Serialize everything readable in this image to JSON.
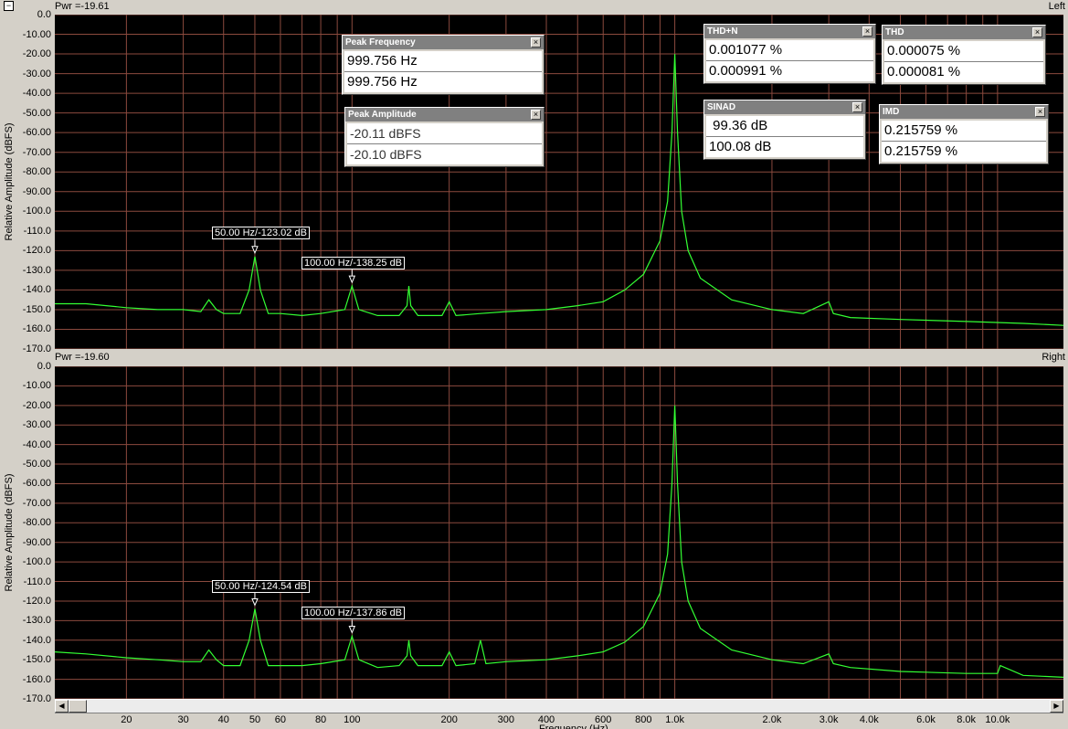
{
  "top_pane": {
    "pwr": "Pwr =-19.61",
    "channel": "Left",
    "markers": [
      {
        "label": "50.00 Hz/-123.02 dB"
      },
      {
        "label": "100.00 Hz/-138.25 dB"
      }
    ]
  },
  "bottom_pane": {
    "pwr": "Pwr =-19.60",
    "channel": "Right",
    "markers": [
      {
        "label": "50.00 Hz/-124.54 dB"
      },
      {
        "label": "100.00 Hz/-137.86 dB"
      }
    ]
  },
  "readouts": {
    "peak_frequency": {
      "title": "Peak Frequency",
      "values": [
        "999.756 Hz",
        "999.756 Hz"
      ]
    },
    "peak_amplitude": {
      "title": "Peak Amplitude",
      "values": [
        "-20.11 dBFS",
        "-20.10 dBFS"
      ]
    },
    "thd_n": {
      "title": "THD+N",
      "values": [
        "0.001077 %",
        "0.000991 %"
      ]
    },
    "thd": {
      "title": "THD",
      "values": [
        "0.000075 %",
        "0.000081 %"
      ]
    },
    "sinad": {
      "title": "SINAD",
      "values": [
        " 99.36 dB",
        "100.08 dB"
      ]
    },
    "imd": {
      "title": "IMD",
      "values": [
        "0.215759 %",
        "0.215759 %"
      ]
    }
  },
  "axes": {
    "y_title": "Relative Amplitude (dBFS)",
    "x_title": "Frequency (Hz)",
    "y_ticks": [
      "0.0",
      "-10.00",
      "-20.00",
      "-30.00",
      "-40.00",
      "-50.00",
      "-60.00",
      "-70.00",
      "-80.00",
      "-90.00",
      "-100.0",
      "-110.0",
      "-120.0",
      "-130.0",
      "-140.0",
      "-150.0",
      "-160.0",
      "-170.0"
    ],
    "x_ticks": [
      "20",
      "30",
      "40",
      "50",
      "60",
      "80",
      "100",
      "200",
      "300",
      "400",
      "600",
      "800",
      "1.0k",
      "2.0k",
      "3.0k",
      "4.0k",
      "6.0k",
      "8.0k",
      "10.0k"
    ]
  },
  "colors": {
    "trace": "#33ff33",
    "grid": "#8b4a3e",
    "background": "#000000"
  },
  "icons": {
    "corner": "window-corner-icon",
    "close": "close-icon",
    "scroll_left": "arrow-left-icon",
    "scroll_right": "arrow-right-icon"
  },
  "chart_data": [
    {
      "type": "line",
      "title": "",
      "xlabel": "Frequency (Hz)",
      "ylabel": "Relative Amplitude (dBFS)",
      "xscale": "log",
      "xlim": [
        12,
        16000
      ],
      "ylim": [
        -170,
        0
      ],
      "grid": true,
      "channel": "Left",
      "series": [
        {
          "x": [
            12,
            15,
            20,
            25,
            30,
            34,
            36,
            38,
            40,
            45,
            48,
            50,
            52,
            55,
            60,
            70,
            80,
            95,
            100,
            105,
            120,
            140,
            148,
            150,
            152,
            160,
            190,
            200,
            210,
            250,
            300,
            400,
            500,
            600,
            700,
            800,
            900,
            950,
            980,
            1000,
            1020,
            1050,
            1100,
            1200,
            1500,
            2000,
            2500,
            3000,
            3100,
            3500,
            5000,
            8000,
            12000,
            16000
          ],
          "y": [
            -147,
            -147,
            -149,
            -150,
            -150,
            -151,
            -145,
            -150,
            -152,
            -152,
            -140,
            -123,
            -140,
            -152,
            -152,
            -153,
            -152,
            -150,
            -138,
            -150,
            -153,
            -153,
            -148,
            -138,
            -148,
            -153,
            -153,
            -146,
            -153,
            -152,
            -151,
            -150,
            -148,
            -146,
            -140,
            -132,
            -115,
            -95,
            -60,
            -20,
            -60,
            -100,
            -120,
            -134,
            -145,
            -150,
            -152,
            -146,
            -152,
            -154,
            -155,
            -156,
            -157,
            -158
          ]
        }
      ]
    },
    {
      "type": "line",
      "title": "",
      "xlabel": "Frequency (Hz)",
      "ylabel": "Relative Amplitude (dBFS)",
      "xscale": "log",
      "xlim": [
        12,
        16000
      ],
      "ylim": [
        -170,
        0
      ],
      "grid": true,
      "channel": "Right",
      "series": [
        {
          "x": [
            12,
            15,
            20,
            25,
            30,
            34,
            36,
            38,
            40,
            45,
            48,
            50,
            52,
            55,
            60,
            70,
            80,
            95,
            100,
            105,
            120,
            140,
            148,
            150,
            152,
            160,
            190,
            200,
            210,
            240,
            250,
            260,
            300,
            400,
            500,
            600,
            700,
            800,
            900,
            950,
            980,
            1000,
            1020,
            1050,
            1100,
            1200,
            1500,
            2000,
            2500,
            3000,
            3100,
            3500,
            5000,
            8000,
            10000,
            10200,
            12000,
            16000
          ],
          "y": [
            -146,
            -147,
            -149,
            -150,
            -151,
            -151,
            -145,
            -150,
            -153,
            -153,
            -140,
            -124,
            -140,
            -153,
            -153,
            -153,
            -152,
            -150,
            -138,
            -150,
            -154,
            -153,
            -148,
            -140,
            -148,
            -153,
            -153,
            -146,
            -153,
            -152,
            -140,
            -152,
            -151,
            -150,
            -148,
            -146,
            -141,
            -133,
            -116,
            -96,
            -60,
            -20,
            -60,
            -100,
            -120,
            -134,
            -145,
            -150,
            -152,
            -147,
            -152,
            -154,
            -156,
            -157,
            -157,
            -153,
            -158,
            -159
          ]
        }
      ]
    }
  ]
}
